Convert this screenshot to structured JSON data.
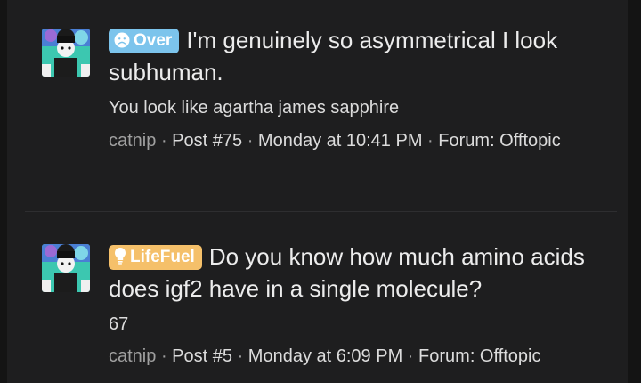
{
  "results": [
    {
      "badge": {
        "label": "Over",
        "color": "#7cc4ec",
        "icon": "sad-face-icon"
      },
      "title": "I'm genuinely so asymmetrical I look subhuman.",
      "snippet": "You look like agartha james sapphire",
      "meta": {
        "author": "catnip",
        "separator": "·",
        "post": "Post #75",
        "datetime": "Monday at 10:41 PM",
        "forum": "Forum: Offtopic"
      }
    },
    {
      "badge": {
        "label": "LifeFuel",
        "color": "#f5c06a",
        "icon": "lightbulb-icon"
      },
      "title": "Do you know how much amino acids does igf2 have in a single molecule?",
      "snippet": "67",
      "meta": {
        "author": "catnip",
        "separator": "·",
        "post": "Post #5",
        "datetime": "Monday at 6:09 PM",
        "forum": "Forum: Offtopic"
      }
    }
  ]
}
